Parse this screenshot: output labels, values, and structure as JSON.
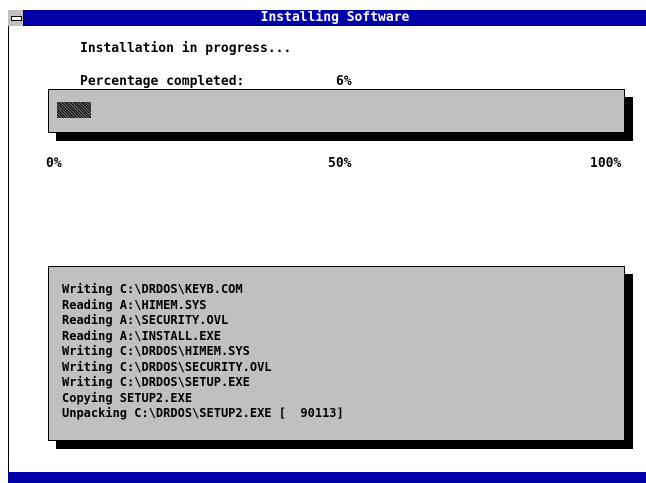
{
  "window": {
    "title": "Installing Software"
  },
  "status": {
    "message": "Installation in progress...",
    "percent_label": "Percentage completed:",
    "percent_value": "6%"
  },
  "progress": {
    "fraction": 0.06,
    "scale_labels": [
      "0%",
      "50%",
      "100%"
    ]
  },
  "log": {
    "lines": [
      "Writing C:\\DRDOS\\KEYB.COM",
      "Reading A:\\HIMEM.SYS",
      "Reading A:\\SECURITY.OVL",
      "Reading A:\\INSTALL.EXE",
      "Writing C:\\DRDOS\\HIMEM.SYS",
      "Writing C:\\DRDOS\\SECURITY.OVL",
      "Writing C:\\DRDOS\\SETUP.EXE",
      "Copying SETUP2.EXE",
      "Unpacking C:\\DRDOS\\SETUP2.EXE [  90113]"
    ]
  },
  "colors": {
    "title_bar": "#0000a8",
    "panel": "#c0c0c0"
  }
}
